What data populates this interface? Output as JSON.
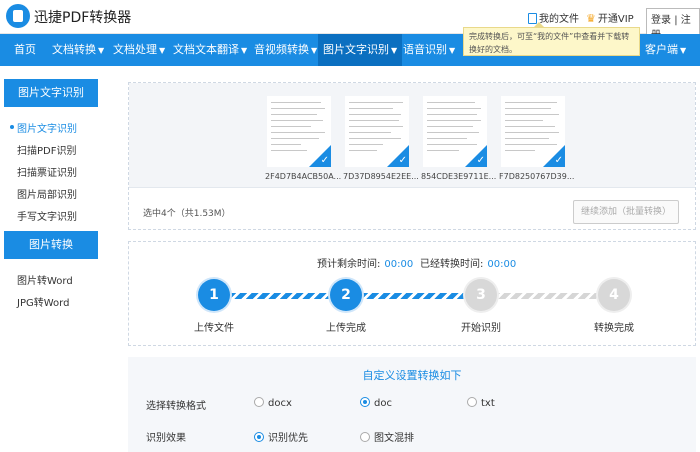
{
  "header": {
    "brand": "迅捷PDF转换器",
    "my_docs": "我的文件",
    "vip": "开通VIP",
    "login": "登录",
    "separator": "|",
    "register": "注册"
  },
  "nav": {
    "items": [
      {
        "label": "首页"
      },
      {
        "label": "文档转换"
      },
      {
        "label": "文档处理"
      },
      {
        "label": "文档文本翻译"
      },
      {
        "label": "音视频转换"
      },
      {
        "label": "图片文字识别"
      },
      {
        "label": "语音识别"
      },
      {
        "label": "客户端"
      }
    ],
    "active_index": 5
  },
  "tooltip": {
    "text": "完成转换后，可至“我的文件”中查看并下载转换好的文档。"
  },
  "sidebar": {
    "group1_title": "图片文字识别",
    "group1_items": [
      "图片文字识别",
      "扫描PDF识别",
      "扫描票证识别",
      "图片局部识别",
      "手写文字识别"
    ],
    "group2_title": "图片转换",
    "group2_items": [
      "图片转Word",
      "JPG转Word"
    ]
  },
  "upload": {
    "files": [
      {
        "name": "2F4D7B4ACB50A..."
      },
      {
        "name": "7D37D8954E2EE..."
      },
      {
        "name": "854CDE3E9711E..."
      },
      {
        "name": "F7D8250767D39..."
      }
    ],
    "selected_count": "选中4个（共1.53M）",
    "add_button": "继续添加（批量转换）"
  },
  "progress": {
    "remaining_label": "预计剩余时间:",
    "remaining_value": "00:00",
    "elapsed_label": "已经转换时间:",
    "elapsed_value": "00:00",
    "steps": [
      {
        "num": "1",
        "label": "上传文件"
      },
      {
        "num": "2",
        "label": "上传完成"
      },
      {
        "num": "3",
        "label": "开始识别"
      },
      {
        "num": "4",
        "label": "转换完成"
      }
    ],
    "completed_steps": 2
  },
  "settings": {
    "title": "自定义设置转换如下",
    "format_label": "选择转换格式",
    "format_options": [
      "docx",
      "doc",
      "txt"
    ],
    "format_selected": "doc",
    "effect_label": "识别效果",
    "effect_options": [
      "识别优先",
      "图文混排"
    ],
    "effect_selected": "识别优先"
  },
  "colors": {
    "accent": "#1a8ce3",
    "nav_active": "#0b6fc0",
    "tooltip_bg": "#fdf7c9"
  }
}
